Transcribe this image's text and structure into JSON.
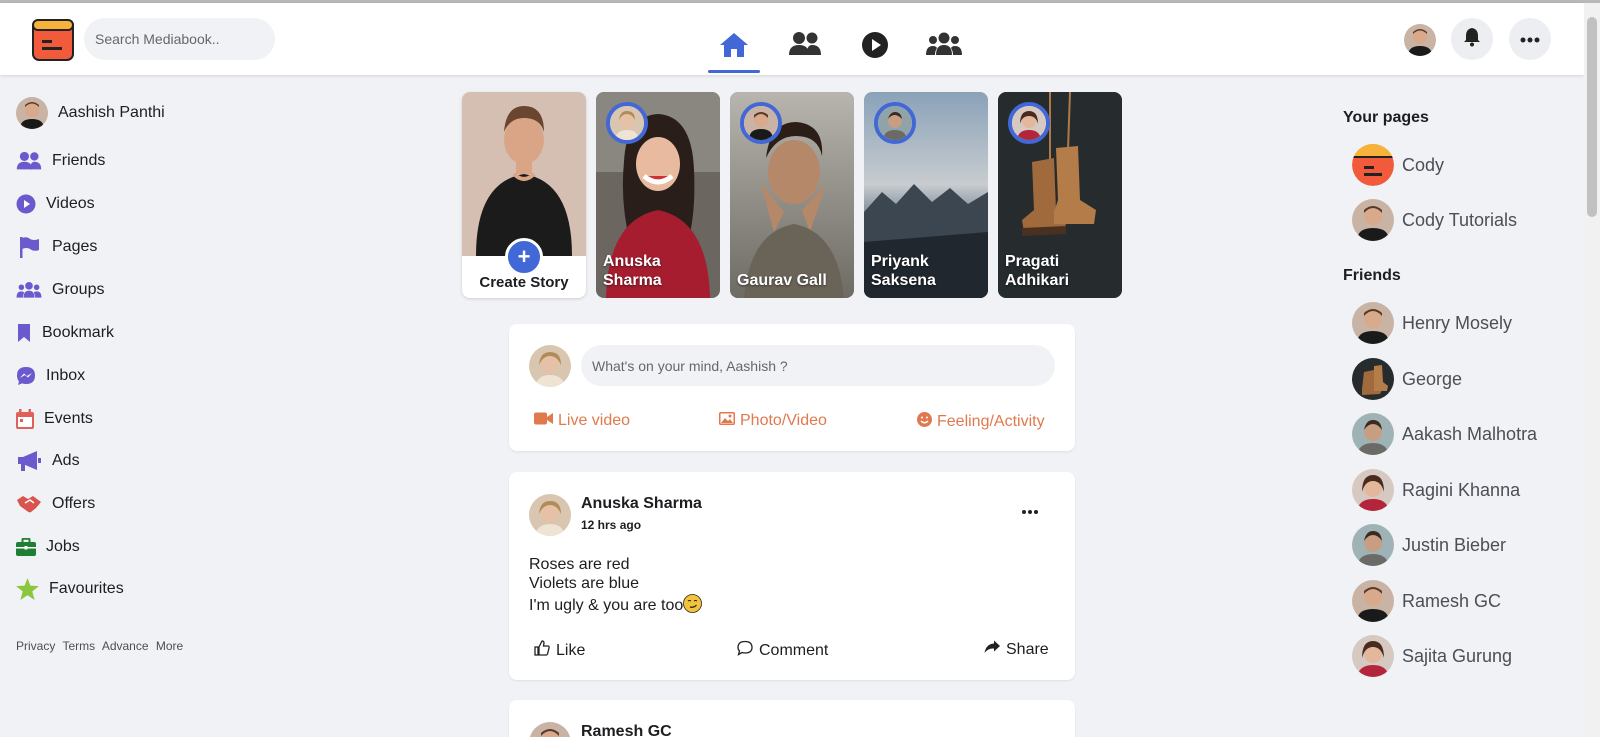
{
  "header": {
    "search_placeholder": "Search Mediabook..",
    "tabs": [
      {
        "icon": "home-icon",
        "active": true
      },
      {
        "icon": "friends-icon",
        "active": false
      },
      {
        "icon": "watch-icon",
        "active": false
      },
      {
        "icon": "groups-icon",
        "active": false
      }
    ],
    "accent": "#4267d6"
  },
  "left_sidebar": {
    "profile_name": "Aashish Panthi",
    "items": [
      {
        "label": "Friends",
        "icon": "friends-icon",
        "color": "#6a5acd"
      },
      {
        "label": "Videos",
        "icon": "video-play-icon",
        "color": "#6a5acd"
      },
      {
        "label": "Pages",
        "icon": "flag-icon",
        "color": "#6a5acd"
      },
      {
        "label": "Groups",
        "icon": "groups-icon",
        "color": "#6a5acd"
      },
      {
        "label": "Bookmark",
        "icon": "bookmark-icon",
        "color": "#6a5acd"
      },
      {
        "label": "Inbox",
        "icon": "messenger-icon",
        "color": "#6a5acd"
      },
      {
        "label": "Events",
        "icon": "calendar-icon",
        "color": "#e0615a"
      },
      {
        "label": "Ads",
        "icon": "megaphone-icon",
        "color": "#6a5acd"
      },
      {
        "label": "Offers",
        "icon": "handshake-icon",
        "color": "#d9534f"
      },
      {
        "label": "Jobs",
        "icon": "briefcase-icon",
        "color": "#1e7e34"
      },
      {
        "label": "Favourites",
        "icon": "star-icon",
        "color": "#8cc63f"
      }
    ],
    "footer": [
      "Privacy",
      "Terms",
      "Advance",
      "More"
    ]
  },
  "stories": {
    "create_label": "Create Story",
    "items": [
      {
        "name_line1": "Anuska",
        "name_line2": "Sharma"
      },
      {
        "name_line1": "Gaurav Gall",
        "name_line2": ""
      },
      {
        "name_line1": "Priyank",
        "name_line2": "Saksena"
      },
      {
        "name_line1": "Pragati",
        "name_line2": "Adhikari"
      }
    ]
  },
  "composer": {
    "placeholder": "What's on your mind, Aashish ?",
    "actions": [
      "Live video",
      "Photo/Video",
      "Feeling/Activity"
    ]
  },
  "posts": [
    {
      "author": "Anuska Sharma",
      "time": "12 hrs ago",
      "lines": [
        "Roses are red",
        "Violets are blue",
        "I'm ugly & you are too"
      ],
      "emoji": "smirk-emoji",
      "actions": [
        "Like",
        "Comment",
        "Share"
      ]
    },
    {
      "author": "Ramesh GC"
    }
  ],
  "right_sidebar": {
    "pages_heading": "Your pages",
    "pages": [
      "Cody",
      "Cody Tutorials"
    ],
    "friends_heading": "Friends",
    "friends": [
      "Henry Mosely",
      "George",
      "Aakash Malhotra",
      "Ragini Khanna",
      "Justin Bieber",
      "Ramesh GC",
      "Sajita Gurung"
    ]
  }
}
